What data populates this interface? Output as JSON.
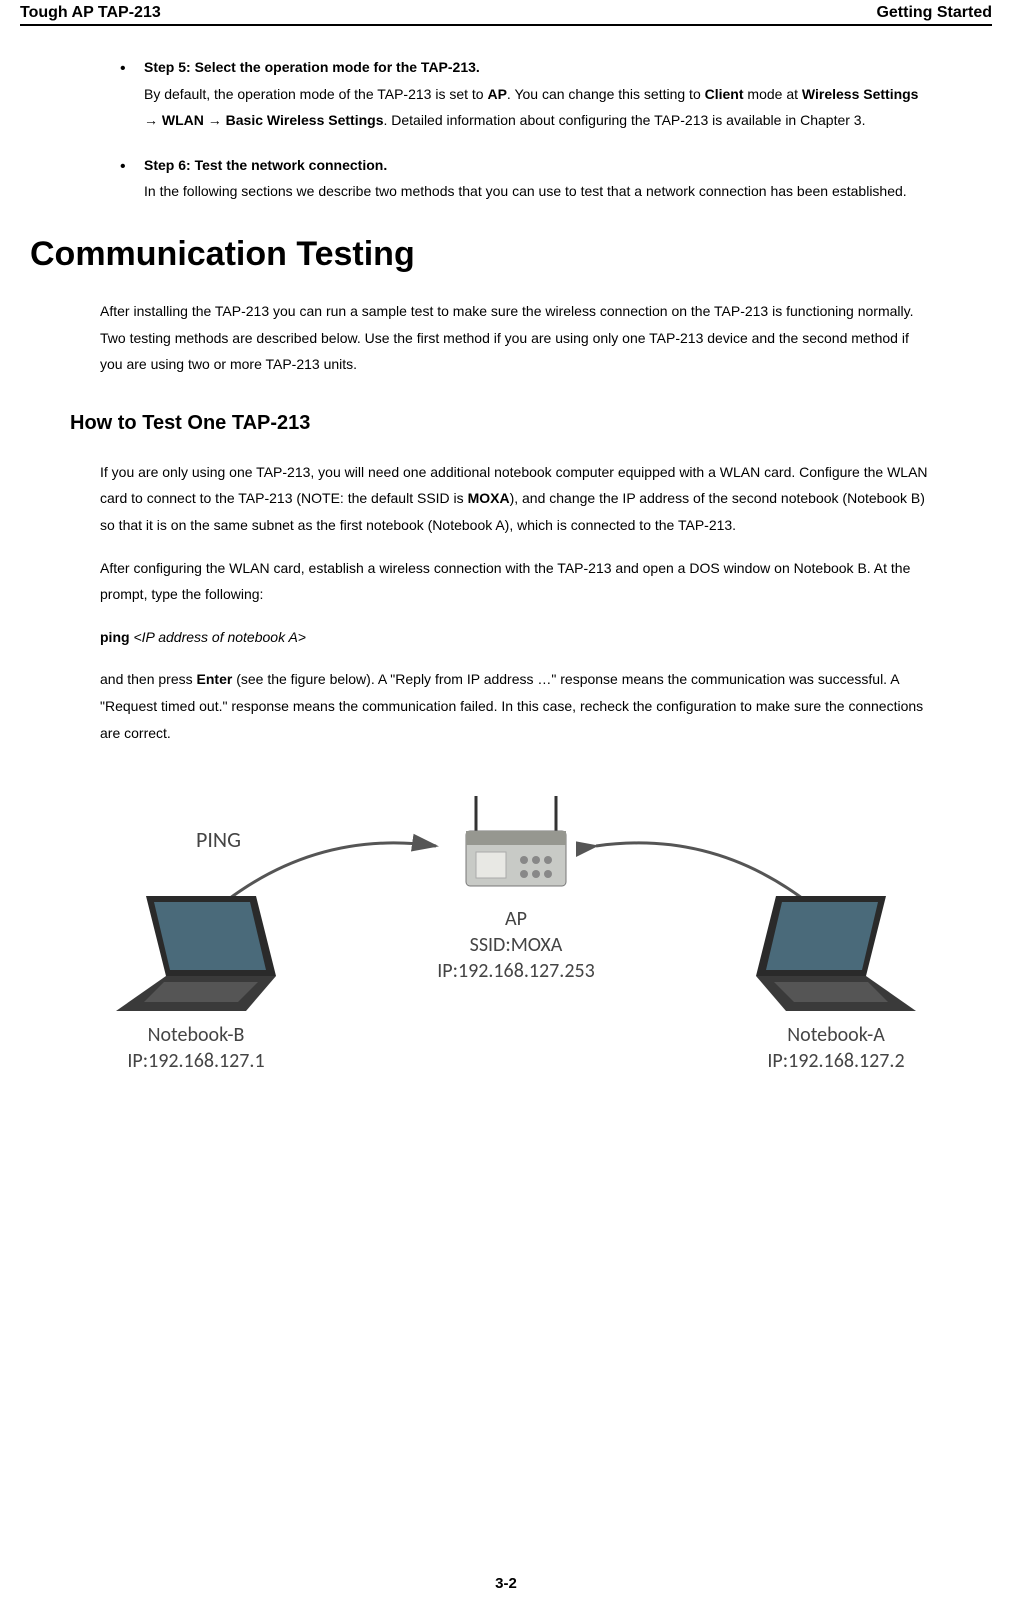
{
  "header": {
    "left": "Tough AP TAP-213",
    "right": "Getting Started"
  },
  "steps": [
    {
      "title": "Step 5: Select the operation mode for the TAP-213.",
      "body_parts": [
        {
          "t": "By default, the operation mode of the TAP-213 is set to "
        },
        {
          "t": "AP",
          "b": true
        },
        {
          "t": ". You can change this setting to "
        },
        {
          "t": "Client",
          "b": true
        },
        {
          "t": " mode at "
        },
        {
          "t": "Wireless Settings → WLAN → Basic Wireless Settings",
          "b": true
        },
        {
          "t": ". Detailed information about configuring the TAP-213 is available in Chapter 3."
        }
      ]
    },
    {
      "title": "Step 6: Test the network connection.",
      "body_parts": [
        {
          "t": "In the following sections we describe two methods that you can use to test that a network connection has been established."
        }
      ]
    }
  ],
  "h1": "Communication Testing",
  "intro": "After installing the TAP-213 you can run a sample test to make sure the wireless connection on the TAP-213 is functioning normally. Two testing methods are described below. Use the first method if you are using only one TAP-213 device and the second method if you are using two or more TAP-213 units.",
  "h2": "How to Test One TAP-213",
  "p1_parts": [
    {
      "t": "If you are only using one TAP-213, you will need one additional notebook computer equipped with a WLAN card. Configure the WLAN card to connect to the TAP-213 (NOTE: the default SSID is "
    },
    {
      "t": "MOXA",
      "b": true
    },
    {
      "t": "), and change the IP address of the second notebook (Notebook B) so that it is on the same subnet as the first notebook (Notebook A), which is connected to the TAP-213."
    }
  ],
  "p2": "After configuring the WLAN card, establish a wireless connection with the TAP-213 and open a DOS window on Notebook B. At the prompt, type the following:",
  "cmd_parts": [
    {
      "t": "ping ",
      "b": true
    },
    {
      "t": "<IP address of notebook A>",
      "i": true
    }
  ],
  "p3_parts": [
    {
      "t": "and then press "
    },
    {
      "t": "Enter",
      "b": true
    },
    {
      "t": " (see the figure below). A \"Reply from IP address …\" response means the communication was successful. A \"Request timed out.\" response means the communication failed. In this case, recheck the configuration to make sure the connections are correct."
    }
  ],
  "diagram": {
    "ping": "PING",
    "ap_line1": "AP",
    "ap_line2": "SSID:MOXA",
    "ap_line3": "IP:192.168.127.253",
    "nb_b_name": "Notebook-B",
    "nb_b_ip": "IP:192.168.127.1",
    "nb_a_name": "Notebook-A",
    "nb_a_ip": "IP:192.168.127.2"
  },
  "footer": "3-2"
}
